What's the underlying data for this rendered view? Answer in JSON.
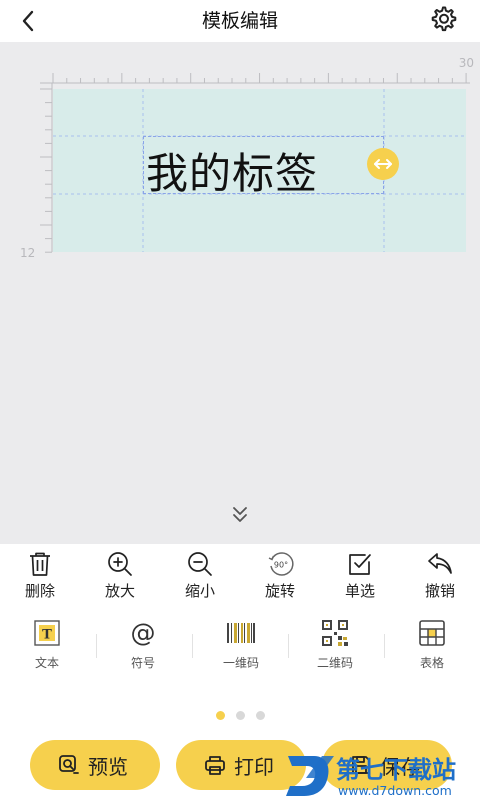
{
  "header": {
    "title": "模板编辑",
    "back_icon": "chevron-left-icon",
    "settings_icon": "gear-icon"
  },
  "canvas": {
    "ruler_top_max": "30",
    "ruler_left_max": "12",
    "label_text": "我的标签",
    "label_background": "#d8ecea",
    "canvas_background": "#ebebed"
  },
  "toolbar": [
    {
      "id": "delete",
      "label": "删除",
      "icon": "trash-icon"
    },
    {
      "id": "zoom-in",
      "label": "放大",
      "icon": "zoom-in-icon"
    },
    {
      "id": "zoom-out",
      "label": "缩小",
      "icon": "zoom-out-icon"
    },
    {
      "id": "rotate",
      "label": "旋转",
      "icon": "rotate-90-icon",
      "icon_text": "90°"
    },
    {
      "id": "single-select",
      "label": "单选",
      "icon": "checkbox-icon"
    },
    {
      "id": "undo",
      "label": "撤销",
      "icon": "undo-icon"
    }
  ],
  "palette": [
    {
      "id": "text",
      "label": "文本",
      "icon": "text-icon"
    },
    {
      "id": "symbol",
      "label": "符号",
      "icon": "at-sign-icon"
    },
    {
      "id": "barcode",
      "label": "一维码",
      "icon": "barcode-icon"
    },
    {
      "id": "qrcode",
      "label": "二维码",
      "icon": "qrcode-icon"
    },
    {
      "id": "table",
      "label": "表格",
      "icon": "table-icon"
    }
  ],
  "pagination": {
    "pages": 3,
    "current": 1
  },
  "bottom": {
    "preview_label": "预览",
    "print_label": "打印",
    "save_label": "保存"
  },
  "watermark": {
    "line1": "第七下载站",
    "line2": "www.d7down.com"
  },
  "colors": {
    "accent": "#f6d04d",
    "selection": "#8aa4e8"
  }
}
